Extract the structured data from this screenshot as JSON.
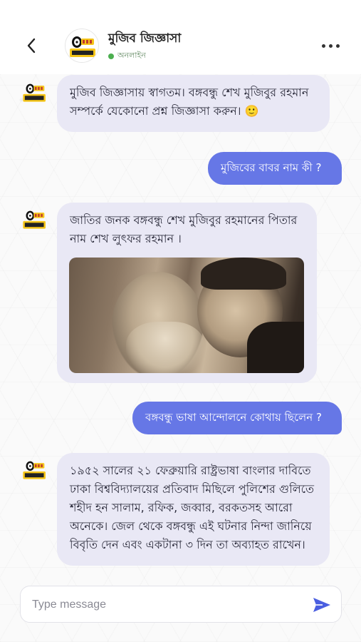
{
  "header": {
    "title": "মুজিব জিজ্ঞাসা",
    "status": "অনলাইন",
    "back_icon": "chevron-left-icon",
    "more_icon": "more-horizontal-icon",
    "avatar_icon": "mascot-logo-icon"
  },
  "messages": [
    {
      "sender": "bot",
      "text": "মুজিব জিজ্ঞাসায় স্বাগতম। বঙ্গবন্ধু শেখ মুজিবুর রহমান সম্পর্কে যেকোনো প্রশ্ন জিজ্ঞাসা করুন। 🙂"
    },
    {
      "sender": "user",
      "text": "মুজিবের বাবর নাম কী ?"
    },
    {
      "sender": "bot",
      "text": "জাতির জনক বঙ্গবন্ধু শেখ মুজিবুর রহমানের পিতার নাম শেখ লুৎফর রহমান ।",
      "image": "historical-photo"
    },
    {
      "sender": "user",
      "text": "বঙ্গবন্ধু ভাষা আন্দোলনে কোথায় ছিলেন ?"
    },
    {
      "sender": "bot",
      "text": "১৯৫২ সালের ২১ ফেব্রুয়ারি রাষ্ট্রভাষা বাংলার দাবিতে ঢাকা বিশ্ববিদ্যালয়ের প্রতিবাদ মিছিলে পুলিশের গুলিতে শহীদ হন সালাম, রফিক, জব্বার, বরকতসহ আরো অনেকে। জেল থেকে বঙ্গবন্ধু এই ঘটনার নিন্দা জানিয়ে বিবৃতি দেন এবং একটানা ৩ দিন তা অব্যাহত রাখেন।"
    }
  ],
  "composer": {
    "placeholder": "Type message",
    "value": "",
    "send_icon": "send-icon"
  },
  "colors": {
    "bot_bubble": "#e9e8f5",
    "user_bubble": "#6677e6",
    "online": "#4caf50"
  }
}
